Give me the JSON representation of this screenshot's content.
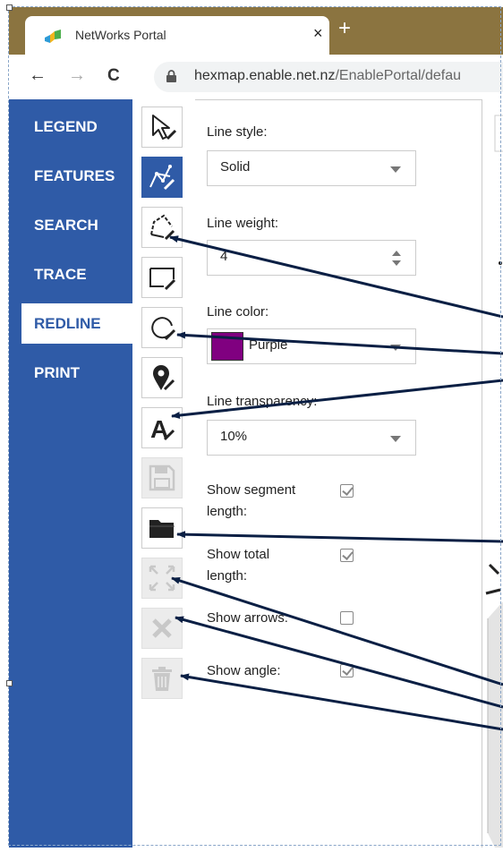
{
  "browser": {
    "tab_title": "NetWorks Portal",
    "tab_close": "×",
    "new_tab": "+",
    "back": "←",
    "forward": "→",
    "reload": "C",
    "url_host": "hexmap.enable.net.nz",
    "url_path": "/EnablePortal/defau"
  },
  "sidebar": {
    "items": [
      {
        "label": "LEGEND"
      },
      {
        "label": "FEATURES"
      },
      {
        "label": "SEARCH"
      },
      {
        "label": "TRACE"
      },
      {
        "label": "REDLINE"
      },
      {
        "label": "PRINT"
      }
    ],
    "active": "REDLINE"
  },
  "toolbar": {
    "tools": [
      {
        "icon": "select-arrow-icon",
        "state": "normal"
      },
      {
        "icon": "freehand-line-icon",
        "state": "active"
      },
      {
        "icon": "polygon-icon",
        "state": "normal"
      },
      {
        "icon": "rectangle-icon",
        "state": "normal"
      },
      {
        "icon": "circle-icon",
        "state": "normal"
      },
      {
        "icon": "marker-icon",
        "state": "normal"
      },
      {
        "icon": "text-icon",
        "state": "normal"
      },
      {
        "icon": "save-icon",
        "state": "disabled"
      },
      {
        "icon": "folder-icon",
        "state": "normal"
      },
      {
        "icon": "expand-icon",
        "state": "disabled"
      },
      {
        "icon": "clear-icon",
        "state": "disabled"
      },
      {
        "icon": "trash-icon",
        "state": "disabled"
      }
    ]
  },
  "panel": {
    "line_style_label": "Line style:",
    "line_style_value": "Solid",
    "line_weight_label": "Line weight:",
    "line_weight_value": "4",
    "line_color_label": "Line color:",
    "line_color_value": "Purple",
    "line_color_hex": "#800080",
    "line_transparency_label": "Line transparency:",
    "line_transparency_value": "10%",
    "show_segment_length_label_1": "Show segment",
    "show_segment_length_label_2": "length:",
    "show_segment_length": true,
    "show_total_length_label_1": "Show total",
    "show_total_length_label_2": "length:",
    "show_total_length": true,
    "show_arrows_label": "Show arrows:",
    "show_arrows": false,
    "show_angle_label": "Show angle:",
    "show_angle": true
  },
  "colors": {
    "sidebar_bg": "#2f5ba7",
    "tab_strip": "#8b7440",
    "annotation_arrow": "#0a1f44"
  }
}
